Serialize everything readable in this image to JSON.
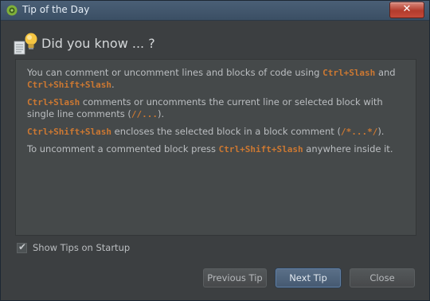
{
  "window": {
    "title": "Tip of the Day",
    "close_glyph": "✕"
  },
  "header": {
    "title": "Did you know ... ?",
    "icon": "lightbulb-icon"
  },
  "tip": {
    "p1": {
      "text_a": "You can comment or uncomment lines and blocks of code using ",
      "code_a": "Ctrl+Slash",
      "text_b": " and ",
      "code_b": "Ctrl+Shift+Slash",
      "text_c": "."
    },
    "p2": {
      "code_a": "Ctrl+Slash",
      "text_a": " comments or uncomments the current line or selected block with single line comments (",
      "code_b": "//...",
      "text_b": ")."
    },
    "p3": {
      "code_a": "Ctrl+Shift+Slash",
      "text_a": " encloses the selected block in a block comment (",
      "code_b": "/*...*/",
      "text_b": ")."
    },
    "p4": {
      "text_a": "To uncomment a commented block press ",
      "code_a": "Ctrl+Shift+Slash",
      "text_b": " anywhere inside it."
    }
  },
  "options": {
    "show_tips_label": "Show Tips on Startup",
    "show_tips_checked": true
  },
  "buttons": {
    "previous": "Previous Tip",
    "next": "Next Tip",
    "close": "Close"
  },
  "colors": {
    "code_keyword": "#cc7832",
    "panel_bg": "#45494a",
    "dialog_bg": "#3c3f41"
  }
}
